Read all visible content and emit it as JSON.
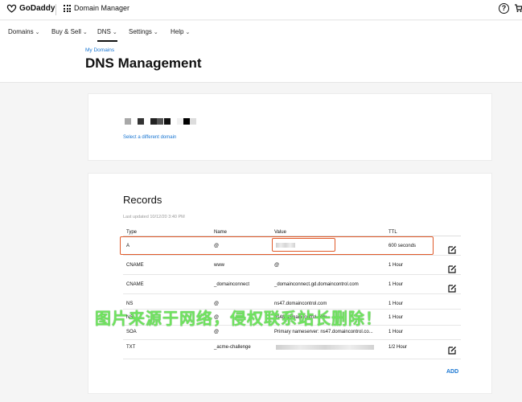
{
  "header": {
    "logo_text": "GoDaddy",
    "app_name": "Domain Manager",
    "icons": [
      "godaddy-logo",
      "grid-icon",
      "help-icon",
      "cart-icon"
    ]
  },
  "nav": {
    "items": [
      {
        "label": "Domains",
        "active": false
      },
      {
        "label": "Buy & Sell",
        "active": false
      },
      {
        "label": "DNS",
        "active": true
      },
      {
        "label": "Settings",
        "active": false
      },
      {
        "label": "Help",
        "active": false
      }
    ]
  },
  "page": {
    "breadcrumb": "My Domains",
    "title": "DNS Management"
  },
  "domain_card": {
    "change_domain_link": "Select a different domain",
    "masked_pixel_colors": [
      "#a8a8a8",
      "#ffffff",
      "#333333",
      "#222222",
      "#555555",
      "#111111",
      "#f0f0f0",
      "#000000",
      "#dddddd"
    ]
  },
  "records": {
    "title": "Records",
    "last_updated": "Last updated 10/12/20 3:40 PM",
    "columns": [
      "Type",
      "Name",
      "Value",
      "TTL"
    ],
    "rows": [
      {
        "type": "A",
        "name": "@",
        "value": "",
        "ttl": "600 seconds",
        "editable": true
      },
      {
        "type": "CNAME",
        "name": "www",
        "value": "@",
        "ttl": "1 Hour",
        "editable": true
      },
      {
        "type": "CNAME",
        "name": "_domainconnect",
        "value": "_domainconnect.gd.domaincontrol.com",
        "ttl": "1 Hour",
        "editable": true
      },
      {
        "type": "NS",
        "name": "@",
        "value": "ns47.domaincontrol.com",
        "ttl": "1 Hour",
        "editable": false
      },
      {
        "type": "NS",
        "name": "@",
        "value": "ns48.domaincontrol.com",
        "ttl": "1 Hour",
        "editable": false
      },
      {
        "type": "SOA",
        "name": "@",
        "value": "Primary nameserver: ns47.domaincontrol.co...",
        "ttl": "1 Hour",
        "editable": false
      },
      {
        "type": "TXT",
        "name": "_acme-challenge",
        "value": "",
        "ttl": "1/2 Hour",
        "editable": true
      }
    ],
    "add_label": "ADD"
  },
  "overlay": {
    "watermark": "图片来源于网络，侵权联系站长删除！"
  },
  "colors": {
    "link_blue": "#1976d2",
    "highlight": "#e05a2a",
    "watermark": "#6fe35f"
  }
}
